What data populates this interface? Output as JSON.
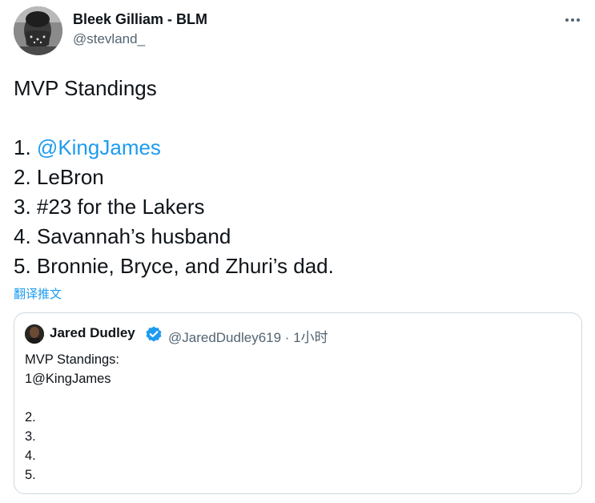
{
  "author": {
    "name": "Bleek Gilliam - BLM",
    "handle": "@stevland_"
  },
  "tweet": {
    "title": "MVP Standings",
    "items": [
      {
        "num": "1. ",
        "text": "@KingJames",
        "is_mention": true
      },
      {
        "num": "2. ",
        "text": "LeBron",
        "is_mention": false
      },
      {
        "num": "3. ",
        "text": "#23 for the Lakers",
        "is_mention": false
      },
      {
        "num": "4. ",
        "text": "Savannah’s husband",
        "is_mention": false
      },
      {
        "num": "5. ",
        "text": "Bronnie, Bryce, and Zhuri’s dad.",
        "is_mention": false
      }
    ]
  },
  "translate_label": "翻译推文",
  "more_icon": "more-horizontal-icon",
  "quote": {
    "name": "Jared Dudley",
    "verified_icon": "verified-badge-icon",
    "handle": "@JaredDudley619",
    "separator": " · ",
    "time": "1小时",
    "lines": [
      "MVP Standings:",
      "1@KingJames",
      "",
      "2.",
      "3.",
      "4.",
      "5."
    ]
  },
  "colors": {
    "link": "#1d9bf0",
    "text": "#0f1419",
    "secondary": "#536471",
    "border": "#cfd9de"
  }
}
